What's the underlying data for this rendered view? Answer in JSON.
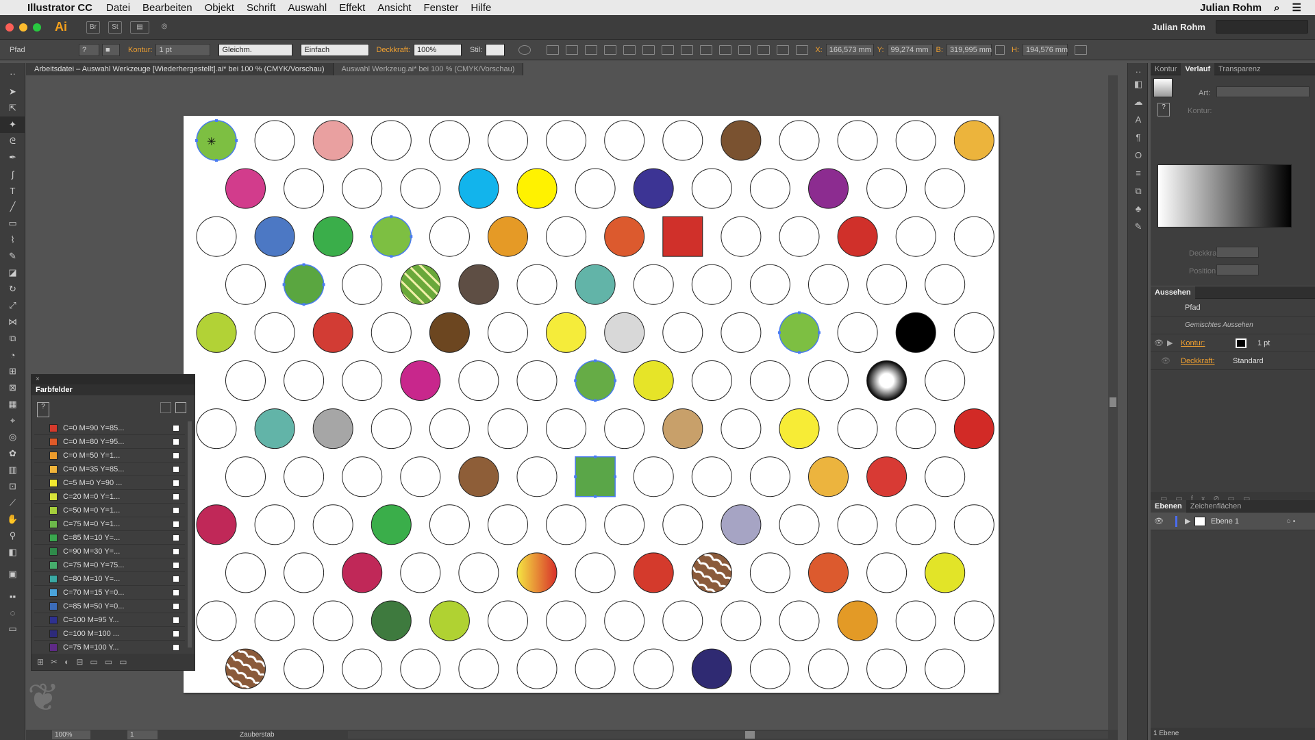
{
  "menubar": {
    "app_name": "Illustrator CC",
    "items": [
      "Datei",
      "Bearbeiten",
      "Objekt",
      "Schrift",
      "Auswahl",
      "Effekt",
      "Ansicht",
      "Fenster",
      "Hilfe"
    ],
    "user": "Julian Rohm"
  },
  "appbar": {
    "logo": "Ai",
    "br": "Br",
    "st": "St",
    "user": "Julian Rohm"
  },
  "control": {
    "selection": "Pfad",
    "kontur_label": "Kontur:",
    "kontur_value": "1 pt",
    "stroke_style": "Gleichm.",
    "stroke_profile": "Einfach",
    "deckkraft_label": "Deckkraft:",
    "deckkraft_value": "100%",
    "stil_label": "Stil:",
    "x_label": "X:",
    "x_value": "166,573 mm",
    "y_label": "Y:",
    "y_value": "99,274 mm",
    "b_label": "B:",
    "b_value": "319,995 mm",
    "h_label": "H:",
    "h_value": "194,576 mm"
  },
  "tabs": [
    "Arbeitsdatei – Auswahl Werkzeuge [Wiederhergestellt].ai* bei 100 % (CMYK/Vorschau)",
    "Auswahl Werkzeug.ai* bei 100 % (CMYK/Vorschau)"
  ],
  "status": {
    "zoom": "100%",
    "page": "1",
    "tool": "Zauberstab"
  },
  "right_panel": {
    "tabs": [
      "Kontur",
      "Verlauf",
      "Transparenz"
    ],
    "art_label": "Art:",
    "kontur_label": "Kontur:",
    "deckkraft_label": "Deckkraft:",
    "position_label": "Position:",
    "aussehen_title": "Aussehen",
    "aussehen_object": "Pfad",
    "aussehen_mixed": "Gemischtes Aussehen",
    "aussehen_kontur": "Kontur:",
    "aussehen_kontur_value": "1 pt",
    "aussehen_deckkraft": "Deckkraft:",
    "aussehen_deckkraft_value": "Standard",
    "layers_tabs": [
      "Ebenen",
      "Zeichenflächen"
    ],
    "layer_name": "Ebene 1",
    "layer_count": "1 Ebene"
  },
  "swatches": {
    "title": "Farbfelder",
    "items": [
      {
        "label": "C=0 M=90 Y=85...",
        "color": "#d43a2c"
      },
      {
        "label": "C=0 M=80 Y=95...",
        "color": "#e05a28"
      },
      {
        "label": "C=0 M=50 Y=1...",
        "color": "#eb9b2c"
      },
      {
        "label": "C=0 M=35 Y=85...",
        "color": "#f0b43a"
      },
      {
        "label": "C=5 M=0 Y=90 ...",
        "color": "#f2e830"
      },
      {
        "label": "C=20 M=0 Y=1...",
        "color": "#d8e43a"
      },
      {
        "label": "C=50 M=0 Y=1...",
        "color": "#a6cf3c"
      },
      {
        "label": "C=75 M=0 Y=1...",
        "color": "#6cb84a"
      },
      {
        "label": "C=85 M=10 Y=...",
        "color": "#3aa64e"
      },
      {
        "label": "C=90 M=30 Y=...",
        "color": "#2f8a4a"
      },
      {
        "label": "C=75 M=0 Y=75...",
        "color": "#46ad6c"
      },
      {
        "label": "C=80 M=10 Y=...",
        "color": "#3aaaa4"
      },
      {
        "label": "C=70 M=15 Y=0...",
        "color": "#4aa4dc"
      },
      {
        "label": "C=85 M=50 Y=0...",
        "color": "#3c6cb8"
      },
      {
        "label": "C=100 M=95 Y...",
        "color": "#2e3190"
      },
      {
        "label": "C=100 M=100 ...",
        "color": "#2d2a7a"
      },
      {
        "label": "C=75 M=100 Y...",
        "color": "#5e2a86"
      }
    ]
  },
  "artboard_circles": {
    "colors": {
      "0,0": "#7dbf42",
      "0,2": "#e9a0a0",
      "0,9": "#7a5230",
      "0,13": "#ecb43c",
      "1,0": "#d23c8c",
      "1,4": "#12b4ec",
      "1,5": "#fff200",
      "1,7": "#3c3494",
      "1,10": "#8c2c90",
      "2,1": "#4c78c4",
      "2,2": "#3aae4a",
      "2,3": "#7dbf42",
      "2,5": "#e59a26",
      "2,7": "#dc5a2e",
      "2,11": "#d0302a",
      "3,1": "#5aa640",
      "3,3": "#pat",
      "3,4": "#5e4e44",
      "3,6": "#62b4a8",
      "4,0": "#b2d236",
      "4,2": "#d23c34",
      "4,4": "#6c4620",
      "4,6": "#f5ec3a",
      "4,7": "#d8d8d8",
      "4,10": "#7dbf42",
      "4,12": "#000000",
      "5,3": "#c8278c",
      "5,6": "#66ac46",
      "5,7": "#e6e428",
      "5,11": "#radial",
      "6,1": "#62b4a8",
      "6,2": "#a6a6a6",
      "6,8": "#c8a06a",
      "6,10": "#f7ec36",
      "6,13": "#d22a26",
      "7,4": "#8e5e38",
      "7,10": "#ecb43e",
      "7,11": "#d83a34",
      "8,0": "#c02858",
      "8,3": "#3aae4a",
      "8,9": "#a6a4c4",
      "9,2": "#c02858",
      "9,5": "#grad",
      "9,7": "#d43a2c",
      "9,8": "#wood",
      "9,10": "#dc5a2e",
      "9,12": "#e2e428",
      "10,3": "#3e7a3e",
      "10,4": "#b0d232",
      "10,11": "#e39a26",
      "11,0": "#wood",
      "11,8": "#2f2a72"
    },
    "squares": {
      "2,8": "#d0302a",
      "7,6": "#5aa648"
    },
    "selected": [
      "0,0",
      "2,3",
      "3,1",
      "4,10",
      "5,6",
      "7,6"
    ]
  }
}
